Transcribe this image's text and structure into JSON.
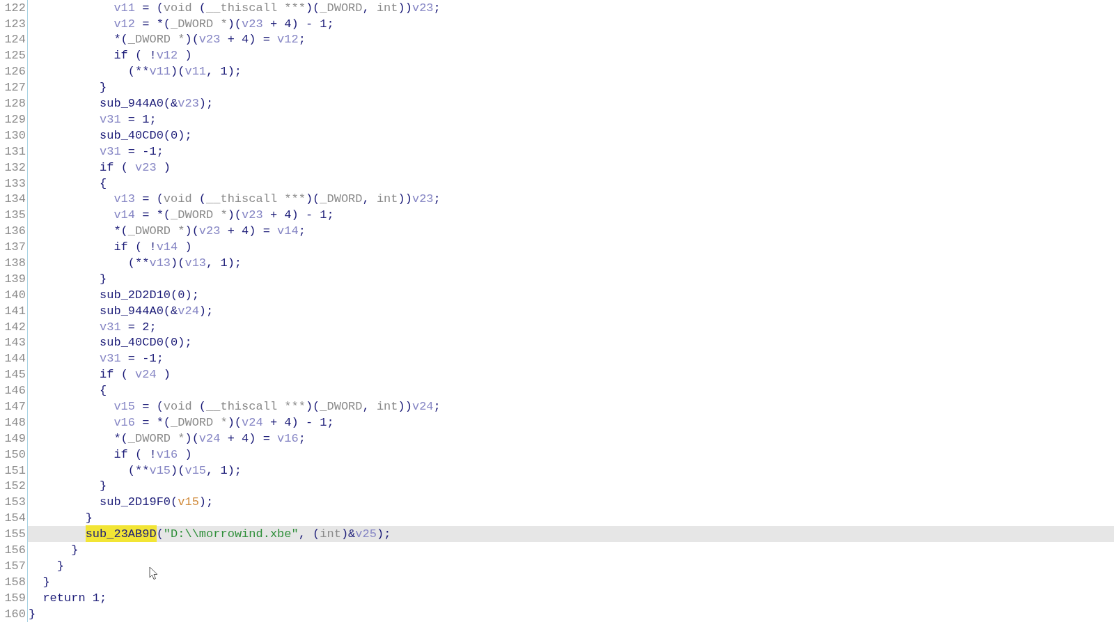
{
  "lines": [
    {
      "number": "122",
      "current": false,
      "tokens": [
        {
          "kind": "var",
          "text": "            v11"
        },
        {
          "kind": "plain",
          "text": " = ("
        },
        {
          "kind": "type",
          "text": "void"
        },
        {
          "kind": "plain",
          "text": " ("
        },
        {
          "kind": "type",
          "text": "__thiscall ***"
        },
        {
          "kind": "plain",
          "text": ")("
        },
        {
          "kind": "type",
          "text": "_DWORD"
        },
        {
          "kind": "plain",
          "text": ", "
        },
        {
          "kind": "type",
          "text": "int"
        },
        {
          "kind": "plain",
          "text": "))"
        },
        {
          "kind": "var",
          "text": "v23"
        },
        {
          "kind": "plain",
          "text": ";"
        }
      ]
    },
    {
      "number": "123",
      "current": false,
      "tokens": [
        {
          "kind": "var",
          "text": "            v12"
        },
        {
          "kind": "plain",
          "text": " = *("
        },
        {
          "kind": "type",
          "text": "_DWORD *"
        },
        {
          "kind": "plain",
          "text": ")("
        },
        {
          "kind": "var",
          "text": "v23"
        },
        {
          "kind": "plain",
          "text": " + 4) - 1;"
        }
      ]
    },
    {
      "number": "124",
      "current": false,
      "tokens": [
        {
          "kind": "plain",
          "text": "            *("
        },
        {
          "kind": "type",
          "text": "_DWORD *"
        },
        {
          "kind": "plain",
          "text": ")("
        },
        {
          "kind": "var",
          "text": "v23"
        },
        {
          "kind": "plain",
          "text": " + 4) = "
        },
        {
          "kind": "var",
          "text": "v12"
        },
        {
          "kind": "plain",
          "text": ";"
        }
      ]
    },
    {
      "number": "125",
      "current": false,
      "tokens": [
        {
          "kind": "plain",
          "text": "            if ( !"
        },
        {
          "kind": "var",
          "text": "v12"
        },
        {
          "kind": "plain",
          "text": " )"
        }
      ]
    },
    {
      "number": "126",
      "current": false,
      "tokens": [
        {
          "kind": "plain",
          "text": "              (**"
        },
        {
          "kind": "var",
          "text": "v11"
        },
        {
          "kind": "plain",
          "text": ")("
        },
        {
          "kind": "var",
          "text": "v11"
        },
        {
          "kind": "plain",
          "text": ", 1);"
        }
      ]
    },
    {
      "number": "127",
      "current": false,
      "tokens": [
        {
          "kind": "plain",
          "text": "          }"
        }
      ]
    },
    {
      "number": "128",
      "current": false,
      "tokens": [
        {
          "kind": "plain",
          "text": "          sub_944A0(&"
        },
        {
          "kind": "var",
          "text": "v23"
        },
        {
          "kind": "plain",
          "text": ");"
        }
      ]
    },
    {
      "number": "129",
      "current": false,
      "tokens": [
        {
          "kind": "var",
          "text": "          v31"
        },
        {
          "kind": "plain",
          "text": " = 1;"
        }
      ]
    },
    {
      "number": "130",
      "current": false,
      "tokens": [
        {
          "kind": "plain",
          "text": "          sub_40CD0(0);"
        }
      ]
    },
    {
      "number": "131",
      "current": false,
      "tokens": [
        {
          "kind": "var",
          "text": "          v31"
        },
        {
          "kind": "plain",
          "text": " = -1;"
        }
      ]
    },
    {
      "number": "132",
      "current": false,
      "tokens": [
        {
          "kind": "plain",
          "text": "          if ( "
        },
        {
          "kind": "var",
          "text": "v23"
        },
        {
          "kind": "plain",
          "text": " )"
        }
      ]
    },
    {
      "number": "133",
      "current": false,
      "tokens": [
        {
          "kind": "plain",
          "text": "          {"
        }
      ]
    },
    {
      "number": "134",
      "current": false,
      "tokens": [
        {
          "kind": "var",
          "text": "            v13"
        },
        {
          "kind": "plain",
          "text": " = ("
        },
        {
          "kind": "type",
          "text": "void"
        },
        {
          "kind": "plain",
          "text": " ("
        },
        {
          "kind": "type",
          "text": "__thiscall ***"
        },
        {
          "kind": "plain",
          "text": ")("
        },
        {
          "kind": "type",
          "text": "_DWORD"
        },
        {
          "kind": "plain",
          "text": ", "
        },
        {
          "kind": "type",
          "text": "int"
        },
        {
          "kind": "plain",
          "text": "))"
        },
        {
          "kind": "var",
          "text": "v23"
        },
        {
          "kind": "plain",
          "text": ";"
        }
      ]
    },
    {
      "number": "135",
      "current": false,
      "tokens": [
        {
          "kind": "var",
          "text": "            v14"
        },
        {
          "kind": "plain",
          "text": " = *("
        },
        {
          "kind": "type",
          "text": "_DWORD *"
        },
        {
          "kind": "plain",
          "text": ")("
        },
        {
          "kind": "var",
          "text": "v23"
        },
        {
          "kind": "plain",
          "text": " + 4) - 1;"
        }
      ]
    },
    {
      "number": "136",
      "current": false,
      "tokens": [
        {
          "kind": "plain",
          "text": "            *("
        },
        {
          "kind": "type",
          "text": "_DWORD *"
        },
        {
          "kind": "plain",
          "text": ")("
        },
        {
          "kind": "var",
          "text": "v23"
        },
        {
          "kind": "plain",
          "text": " + 4) = "
        },
        {
          "kind": "var",
          "text": "v14"
        },
        {
          "kind": "plain",
          "text": ";"
        }
      ]
    },
    {
      "number": "137",
      "current": false,
      "tokens": [
        {
          "kind": "plain",
          "text": "            if ( !"
        },
        {
          "kind": "var",
          "text": "v14"
        },
        {
          "kind": "plain",
          "text": " )"
        }
      ]
    },
    {
      "number": "138",
      "current": false,
      "tokens": [
        {
          "kind": "plain",
          "text": "              (**"
        },
        {
          "kind": "var",
          "text": "v13"
        },
        {
          "kind": "plain",
          "text": ")("
        },
        {
          "kind": "var",
          "text": "v13"
        },
        {
          "kind": "plain",
          "text": ", 1);"
        }
      ]
    },
    {
      "number": "139",
      "current": false,
      "tokens": [
        {
          "kind": "plain",
          "text": "          }"
        }
      ]
    },
    {
      "number": "140",
      "current": false,
      "tokens": [
        {
          "kind": "plain",
          "text": "          sub_2D2D10(0);"
        }
      ]
    },
    {
      "number": "141",
      "current": false,
      "tokens": [
        {
          "kind": "plain",
          "text": "          sub_944A0(&"
        },
        {
          "kind": "var",
          "text": "v24"
        },
        {
          "kind": "plain",
          "text": ");"
        }
      ]
    },
    {
      "number": "142",
      "current": false,
      "tokens": [
        {
          "kind": "var",
          "text": "          v31"
        },
        {
          "kind": "plain",
          "text": " = 2;"
        }
      ]
    },
    {
      "number": "143",
      "current": false,
      "tokens": [
        {
          "kind": "plain",
          "text": "          sub_40CD0(0);"
        }
      ]
    },
    {
      "number": "144",
      "current": false,
      "tokens": [
        {
          "kind": "var",
          "text": "          v31"
        },
        {
          "kind": "plain",
          "text": " = -1;"
        }
      ]
    },
    {
      "number": "145",
      "current": false,
      "tokens": [
        {
          "kind": "plain",
          "text": "          if ( "
        },
        {
          "kind": "var",
          "text": "v24"
        },
        {
          "kind": "plain",
          "text": " )"
        }
      ]
    },
    {
      "number": "146",
      "current": false,
      "tokens": [
        {
          "kind": "plain",
          "text": "          {"
        }
      ]
    },
    {
      "number": "147",
      "current": false,
      "tokens": [
        {
          "kind": "var",
          "text": "            v15"
        },
        {
          "kind": "plain",
          "text": " = ("
        },
        {
          "kind": "type",
          "text": "void"
        },
        {
          "kind": "plain",
          "text": " ("
        },
        {
          "kind": "type",
          "text": "__thiscall ***"
        },
        {
          "kind": "plain",
          "text": ")("
        },
        {
          "kind": "type",
          "text": "_DWORD"
        },
        {
          "kind": "plain",
          "text": ", "
        },
        {
          "kind": "type",
          "text": "int"
        },
        {
          "kind": "plain",
          "text": "))"
        },
        {
          "kind": "var",
          "text": "v24"
        },
        {
          "kind": "plain",
          "text": ";"
        }
      ]
    },
    {
      "number": "148",
      "current": false,
      "tokens": [
        {
          "kind": "var",
          "text": "            v16"
        },
        {
          "kind": "plain",
          "text": " = *("
        },
        {
          "kind": "type",
          "text": "_DWORD *"
        },
        {
          "kind": "plain",
          "text": ")("
        },
        {
          "kind": "var",
          "text": "v24"
        },
        {
          "kind": "plain",
          "text": " + 4) - 1;"
        }
      ]
    },
    {
      "number": "149",
      "current": false,
      "tokens": [
        {
          "kind": "plain",
          "text": "            *("
        },
        {
          "kind": "type",
          "text": "_DWORD *"
        },
        {
          "kind": "plain",
          "text": ")("
        },
        {
          "kind": "var",
          "text": "v24"
        },
        {
          "kind": "plain",
          "text": " + 4) = "
        },
        {
          "kind": "var",
          "text": "v16"
        },
        {
          "kind": "plain",
          "text": ";"
        }
      ]
    },
    {
      "number": "150",
      "current": false,
      "tokens": [
        {
          "kind": "plain",
          "text": "            if ( !"
        },
        {
          "kind": "var",
          "text": "v16"
        },
        {
          "kind": "plain",
          "text": " )"
        }
      ]
    },
    {
      "number": "151",
      "current": false,
      "tokens": [
        {
          "kind": "plain",
          "text": "              (**"
        },
        {
          "kind": "var",
          "text": "v15"
        },
        {
          "kind": "plain",
          "text": ")("
        },
        {
          "kind": "var",
          "text": "v15"
        },
        {
          "kind": "plain",
          "text": ", 1);"
        }
      ]
    },
    {
      "number": "152",
      "current": false,
      "tokens": [
        {
          "kind": "plain",
          "text": "          }"
        }
      ]
    },
    {
      "number": "153",
      "current": false,
      "tokens": [
        {
          "kind": "plain",
          "text": "          sub_2D19F0("
        },
        {
          "kind": "arg",
          "text": "v15"
        },
        {
          "kind": "plain",
          "text": ");"
        }
      ]
    },
    {
      "number": "154",
      "current": false,
      "tokens": [
        {
          "kind": "plain",
          "text": "        }"
        }
      ]
    },
    {
      "number": "155",
      "current": true,
      "tokens": [
        {
          "kind": "mark",
          "text": "        sub_23AB9D"
        },
        {
          "kind": "plain",
          "text": "("
        },
        {
          "kind": "string",
          "text": "\"D:\\\\morrowind.xbe\""
        },
        {
          "kind": "plain",
          "text": ", ("
        },
        {
          "kind": "type",
          "text": "int"
        },
        {
          "kind": "plain",
          "text": ")&"
        },
        {
          "kind": "var",
          "text": "v25"
        },
        {
          "kind": "plain",
          "text": ");"
        }
      ]
    },
    {
      "number": "156",
      "current": false,
      "tokens": [
        {
          "kind": "plain",
          "text": "      }"
        }
      ]
    },
    {
      "number": "157",
      "current": false,
      "tokens": [
        {
          "kind": "plain",
          "text": "    }"
        }
      ]
    },
    {
      "number": "158",
      "current": false,
      "tokens": [
        {
          "kind": "plain",
          "text": "  }"
        }
      ]
    },
    {
      "number": "159",
      "current": false,
      "tokens": [
        {
          "kind": "plain",
          "text": "  return 1;"
        }
      ]
    },
    {
      "number": "160",
      "current": false,
      "tokens": [
        {
          "kind": "plain",
          "text": "}"
        }
      ]
    }
  ]
}
